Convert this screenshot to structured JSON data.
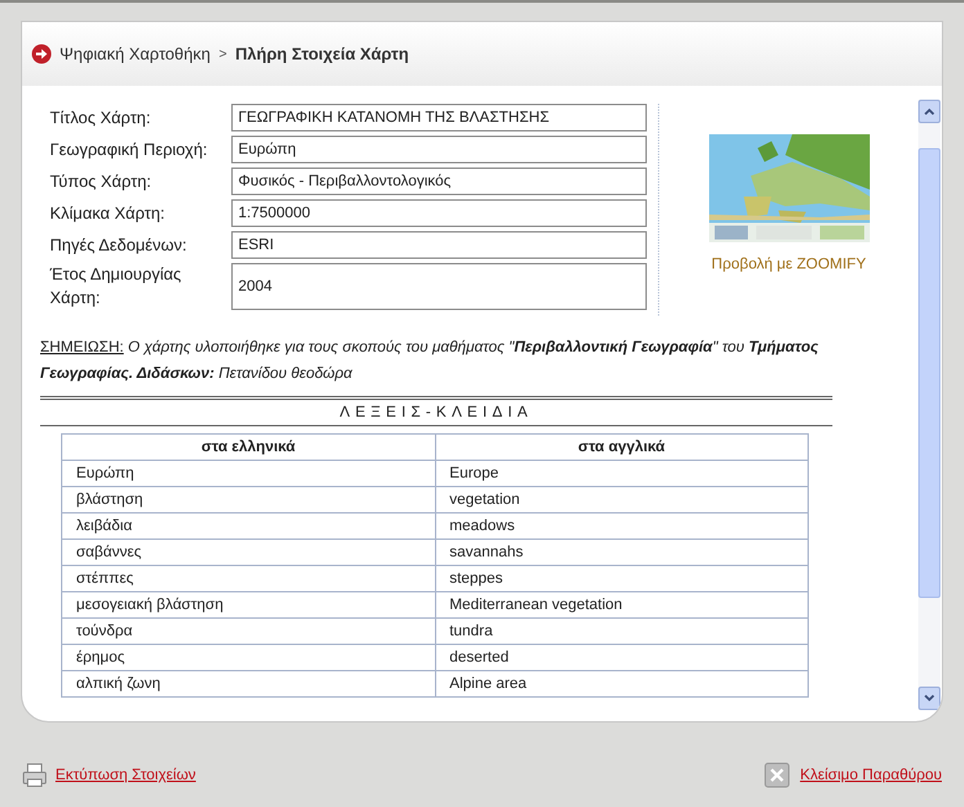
{
  "breadcrumb": {
    "parent": "Ψηφιακή Χαρτοθήκη",
    "separator": ">",
    "current": "Πλήρη Στοιχεία Χάρτη"
  },
  "fields": [
    {
      "label": "Τίτλος Χάρτη:",
      "value": "ΓΕΩΓΡΑΦΙΚΗ ΚΑΤΑΝΟΜΗ ΤΗΣ ΒΛΑΣΤΗΣΗΣ"
    },
    {
      "label": "Γεωγραφική Περιοχή:",
      "value": "Ευρώπη"
    },
    {
      "label": "Τύπος Χάρτη:",
      "value": "Φυσικός - Περιβαλλοντολογικός"
    },
    {
      "label": "Κλίμακα Χάρτη:",
      "value": "1:7500000"
    },
    {
      "label": "Πηγές Δεδομένων:",
      "value": "ESRI"
    },
    {
      "label": "Έτος Δημιουργίας Χάρτη:",
      "value": "2004"
    }
  ],
  "preview": {
    "link": "Προβολή με ZOOMIFY"
  },
  "note": {
    "label": "ΣΗΜΕΙΩΣΗ:",
    "text": "Ο χάρτης υλοποιήθηκε για τους σκοπούς του μαθήματος \"**Περιβαλλοντική Γεωγραφία**\" του **Τμήματος Γεωγραφίας. Διδάσκων:** Πετανίδου θεοδώρα"
  },
  "keywords": {
    "title": "ΛΕΞΕΙΣ-ΚΛΕΙΔΙΑ",
    "columns": [
      "στα ελληνικά",
      "στα αγγλικά"
    ],
    "rows": [
      [
        "Ευρώπη",
        "Europe"
      ],
      [
        "βλάστηση",
        "vegetation"
      ],
      [
        "λειβάδια",
        "meadows"
      ],
      [
        "σαβάννες",
        "savannahs"
      ],
      [
        "στέππες",
        "steppes"
      ],
      [
        "μεσογειακή βλάστηση",
        "Mediterranean vegetation"
      ],
      [
        "τούνδρα",
        "tundra"
      ],
      [
        "έρημος",
        "deserted"
      ],
      [
        "αλπική ζωνη",
        "Alpine area"
      ]
    ]
  },
  "footer": {
    "print": "Εκτύπωση Στοιχείων",
    "close": "Κλείσιμο Παραθύρου"
  }
}
